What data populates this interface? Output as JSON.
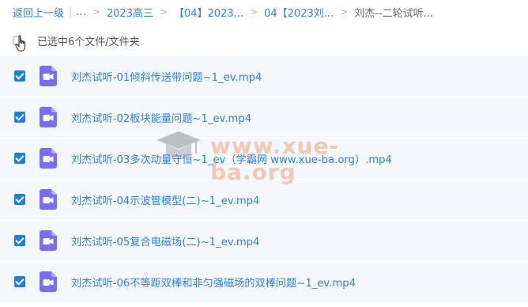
{
  "breadcrumb": {
    "back": "返回上一级",
    "ellipsis": "...",
    "items": [
      "2023高三",
      "【04】2023...",
      "04【2023刘...",
      "刘杰--二轮试听..."
    ]
  },
  "selection": {
    "text": "已选中6个文件/文件夹"
  },
  "files": [
    {
      "name": "刘杰试听-01倾斜传送带问题~1_ev.mp4",
      "checked": true
    },
    {
      "name": "刘杰试听-02板块能量问题~1_ev.mp4",
      "checked": true
    },
    {
      "name": "刘杰试听-03多次动量守恒~1_ev（学霸网 www.xue-ba.org）.mp4",
      "checked": true
    },
    {
      "name": "刘杰试听-04示波管模型(二)~1_ev.mp4",
      "checked": true
    },
    {
      "name": "刘杰试听-05复合电磁场(二)~1_ev.mp4",
      "checked": true
    },
    {
      "name": "刘杰试听-06不等距双棒和非匀强磁场的双棒问题~1_ev.mp4",
      "checked": true
    }
  ],
  "watermark": {
    "text": "www.xue-ba.org",
    "icon": "graduation-cap-icon"
  },
  "colors": {
    "link": "#2f7fd6",
    "row_bg": "#f4f8fc",
    "checkbox": "#1f7fe0",
    "video_icon": "#7b6cf6"
  }
}
